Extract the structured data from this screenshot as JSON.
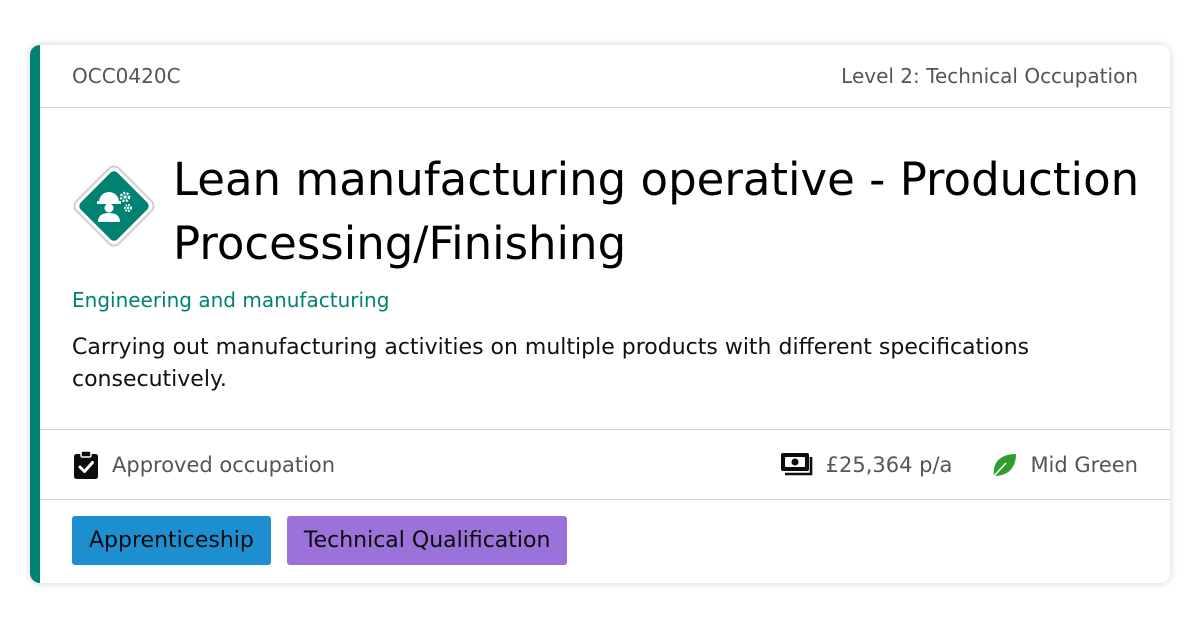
{
  "header": {
    "code": "OCC0420C",
    "level": "Level 2: Technical Occupation"
  },
  "occupation": {
    "title": "Lean manufacturing operative - Production Processing/Finishing",
    "category": "Engineering and manufacturing",
    "description": "Carrying out manufacturing activities on multiple products with different specifications consecutively.",
    "icon": "engineer-gears-icon"
  },
  "meta": {
    "status": "Approved occupation",
    "salary": "£25,364 p/a",
    "green_rating": "Mid Green"
  },
  "tags": [
    {
      "label": "Apprenticeship",
      "color": "#1d8fd1"
    },
    {
      "label": "Technical Qualification",
      "color": "#9b72d9"
    }
  ],
  "colors": {
    "accent": "#008272",
    "green_leaf": "#2e9e2e"
  }
}
